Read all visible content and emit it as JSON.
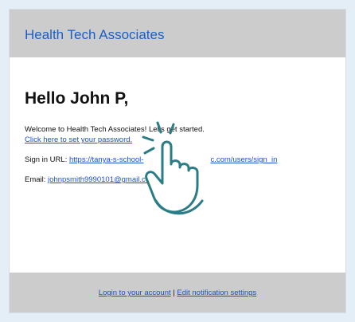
{
  "header": {
    "brand": "Health Tech Associates"
  },
  "email": {
    "greeting": "Hello John P,",
    "welcome_text": "Welcome to Health Tech Associates! Let's get started.",
    "set_password_link": "Click here to set your password.",
    "signin_label": "Sign in URL:",
    "signin_url_start": "https://tanya-s-school-",
    "signin_url_end": "c.com/users/sign_in",
    "email_label": "Email:",
    "email_address": "johnpsmith9990101@gmail.co"
  },
  "footer": {
    "login_link": "Login to your account",
    "separator": "|",
    "settings_link": "Edit notification settings"
  },
  "colors": {
    "brand": "#1a5fc8",
    "link": "#1a4fd6",
    "banner_gray": "#cccccc",
    "page_bg": "#e3eef7",
    "hand_outline": "#2a7d86"
  },
  "overlay": {
    "icon": "pointing-hand-click-icon"
  }
}
